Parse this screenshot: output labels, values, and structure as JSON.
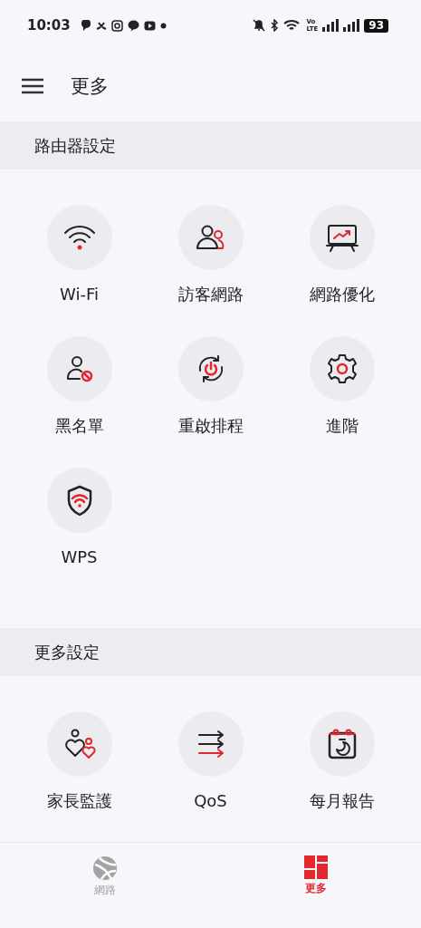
{
  "status_bar": {
    "time": "10:03",
    "volte_top": "Vo",
    "volte_bottom": "LTE",
    "battery": "93"
  },
  "header": {
    "title": "更多"
  },
  "sections": [
    {
      "title": "路由器設定",
      "items": [
        {
          "label": "Wi-Fi"
        },
        {
          "label": "訪客網路"
        },
        {
          "label": "網路優化"
        },
        {
          "label": "黑名單"
        },
        {
          "label": "重啟排程"
        },
        {
          "label": "進階"
        },
        {
          "label": "WPS"
        }
      ]
    },
    {
      "title": "更多設定",
      "items": [
        {
          "label": "家長監護"
        },
        {
          "label": "QoS"
        },
        {
          "label": "每月報告"
        }
      ]
    }
  ],
  "bottom_nav": [
    {
      "label": "網路",
      "selected": false
    },
    {
      "label": "更多",
      "selected": true
    }
  ]
}
